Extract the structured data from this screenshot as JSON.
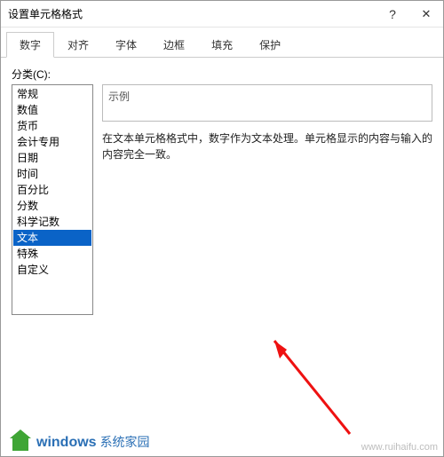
{
  "titlebar": {
    "title": "设置单元格格式",
    "help_symbol": "?",
    "close_symbol": "✕"
  },
  "tabs": [
    {
      "label": "数字",
      "active": true
    },
    {
      "label": "对齐",
      "active": false
    },
    {
      "label": "字体",
      "active": false
    },
    {
      "label": "边框",
      "active": false
    },
    {
      "label": "填充",
      "active": false
    },
    {
      "label": "保护",
      "active": false
    }
  ],
  "category": {
    "label": "分类(C):",
    "items": [
      "常规",
      "数值",
      "货币",
      "会计专用",
      "日期",
      "时间",
      "百分比",
      "分数",
      "科学记数",
      "文本",
      "特殊",
      "自定义"
    ],
    "selected_index": 9
  },
  "sample": {
    "label": "示例"
  },
  "description": "在文本单元格格式中，数字作为文本处理。单元格显示的内容与输入的内容完全一致。",
  "watermark": {
    "brand1": "windows",
    "brand2": "系统家园",
    "url": "www.ruihaifu.com"
  }
}
